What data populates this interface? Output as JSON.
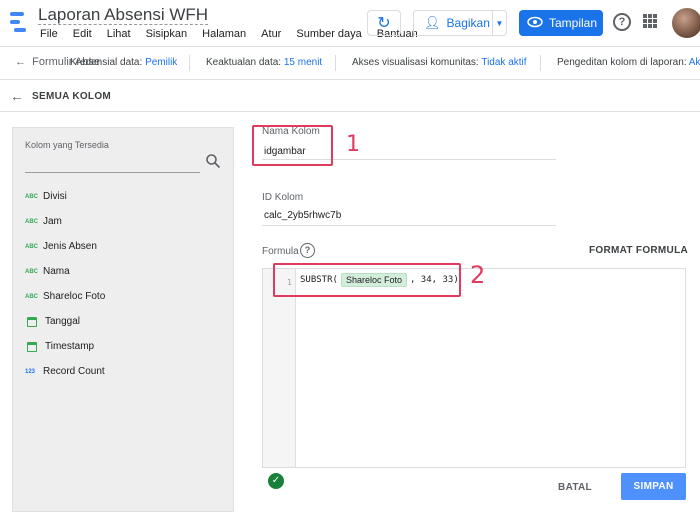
{
  "app": {
    "title": "Laporan Absensi WFH",
    "menu": [
      "File",
      "Edit",
      "Lihat",
      "Sisipkan",
      "Halaman",
      "Atur",
      "Sumber daya",
      "Bantuan"
    ],
    "share_label": "Bagikan",
    "view_label": "Tampilan"
  },
  "infobar": {
    "form_tab": "Formulir Abse",
    "credential_label": "Kredensial data:",
    "credential_value": "Pemilik",
    "freshness_label": "Keaktualan data:",
    "freshness_value": "15 menit",
    "community_label": "Akses visualisasi komunitas:",
    "community_value": "Tidak aktif",
    "edit_label": "Pengeditan kolom di laporan:",
    "edit_value": "Akti"
  },
  "back": {
    "label": "SEMUA KOLOM"
  },
  "left_panel": {
    "title": "Kolom yang Tersedia",
    "fields": [
      {
        "type": "ABC",
        "name": "Divisi"
      },
      {
        "type": "ABC",
        "name": "Jam"
      },
      {
        "type": "ABC",
        "name": "Jenis Absen"
      },
      {
        "type": "ABC",
        "name": "Nama"
      },
      {
        "type": "ABC",
        "name": "Shareloc Foto"
      },
      {
        "type": "calendar",
        "name": "Tanggal"
      },
      {
        "type": "calendar",
        "name": "Timestamp"
      },
      {
        "type": "123",
        "name": "Record Count"
      }
    ]
  },
  "form": {
    "name_label": "Nama Kolom",
    "name_value": "idgambar",
    "id_label": "ID Kolom",
    "id_value": "calc_2yb5rhwc7b",
    "formula_label": "Formula",
    "format_formula": "FORMAT FORMULA",
    "line_number": "1",
    "formula_fn": "SUBSTR(",
    "formula_chip": "Shareloc Foto",
    "formula_rest": ", 34, 33)",
    "annotation_1": "1",
    "annotation_2": "2",
    "cancel_label": "BATAL",
    "save_label": "SIMPAN"
  },
  "colors": {
    "accent": "#1a73e8",
    "annotation": "#e03a5c",
    "save": "#4d90fe",
    "ok": "#188038"
  }
}
